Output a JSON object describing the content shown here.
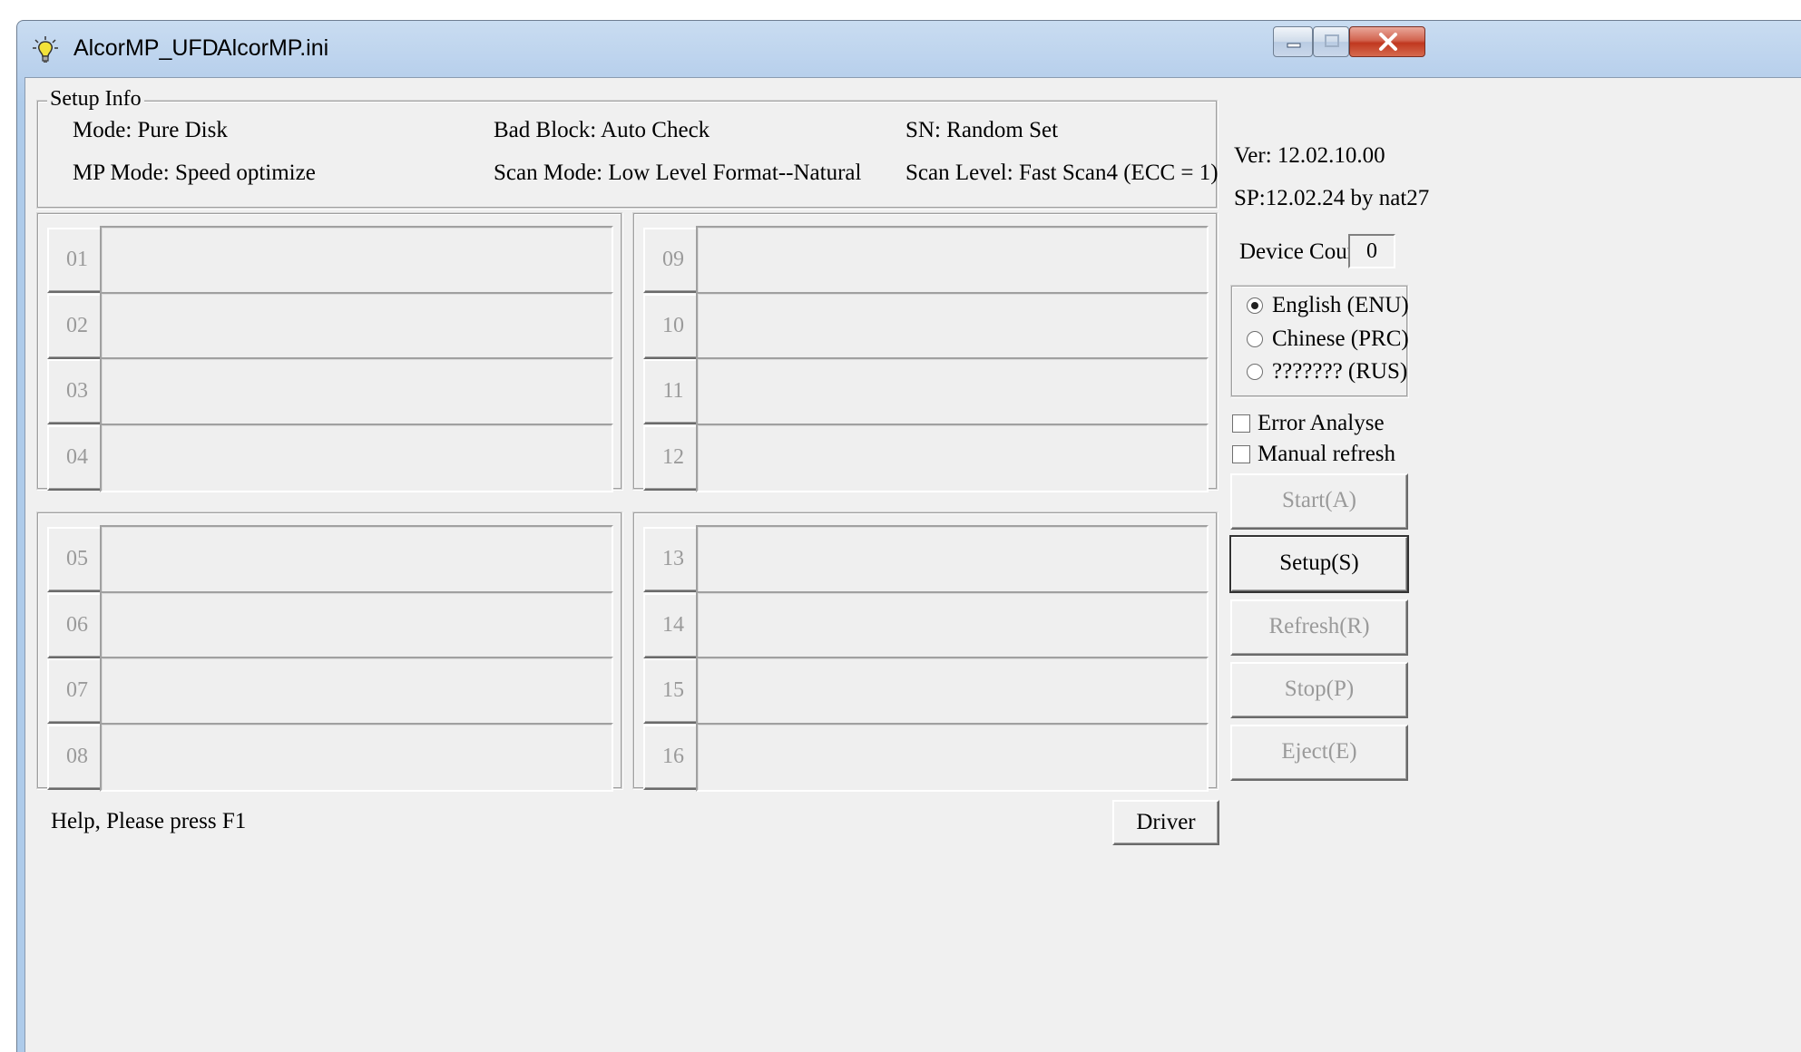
{
  "window": {
    "app_name": "AlcorMP_UFD",
    "ini_file": "AlcorMP.ini",
    "icon": "lightbulb-icon"
  },
  "setup_info": {
    "legend": "Setup Info",
    "mode": "Mode: Pure Disk",
    "bad_block": "Bad Block: Auto Check",
    "sn": "SN: Random Set",
    "mp_mode": "MP Mode: Speed optimize",
    "scan_mode": "Scan Mode: Low Level Format--Natural",
    "scan_level": "Scan Level: Fast Scan4 (ECC = 1)"
  },
  "ports": [
    "01",
    "02",
    "03",
    "04",
    "05",
    "06",
    "07",
    "08",
    "09",
    "10",
    "11",
    "12",
    "13",
    "14",
    "15",
    "16"
  ],
  "side": {
    "version": "Ver: 12.02.10.00",
    "sp": "SP:12.02.24 by nat27",
    "device_count_label": "Device Count:",
    "device_count": "0",
    "languages": [
      {
        "label": "English (ENU)",
        "selected": true
      },
      {
        "label": "Chinese (PRC)",
        "selected": false
      },
      {
        "label": "??????? (RUS)",
        "selected": false
      }
    ],
    "error_analyse": "Error Analyse",
    "manual_refresh": "Manual refresh"
  },
  "buttons": {
    "start": "Start(A)",
    "setup": "Setup(S)",
    "refresh": "Refresh(R)",
    "stop": "Stop(P)",
    "eject": "Eject(E)",
    "driver": "Driver"
  },
  "status": {
    "help": "Help, Please press F1"
  }
}
